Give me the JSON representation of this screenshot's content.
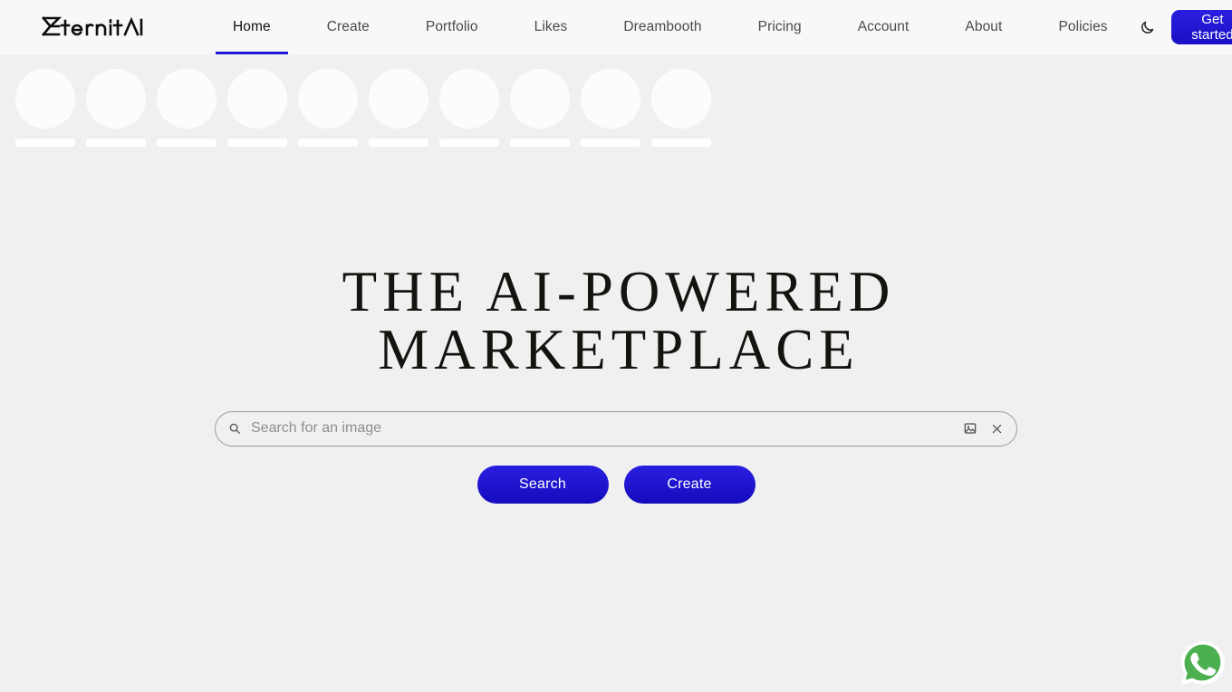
{
  "header": {
    "logo_text": "EternitAI",
    "logo_icon": "eternitai-wordmark",
    "nav": [
      {
        "label": "Home",
        "active": true
      },
      {
        "label": "Create",
        "active": false
      },
      {
        "label": "Portfolio",
        "active": false
      },
      {
        "label": "Likes",
        "active": false
      },
      {
        "label": "Dreambooth",
        "active": false
      },
      {
        "label": "Pricing",
        "active": false
      },
      {
        "label": "Account",
        "active": false
      },
      {
        "label": "About",
        "active": false
      },
      {
        "label": "Policies",
        "active": false
      }
    ],
    "theme_toggle_icon": "moon-icon",
    "get_started_label": "Get started"
  },
  "skeleton": {
    "count": 10,
    "circle_color": "#fcfcfc",
    "bar_color": "#ffffff"
  },
  "hero": {
    "title_line1": "THE AI-POWERED",
    "title_line2": "MARKETPLACE"
  },
  "search": {
    "placeholder": "Search for an image",
    "value": "",
    "search_icon": "search-icon",
    "image_upload_icon": "image-icon",
    "clear_icon": "close-icon"
  },
  "actions": {
    "search_label": "Search",
    "create_label": "Create"
  },
  "floating": {
    "whatsapp_icon": "whatsapp-icon"
  },
  "colors": {
    "accent": "#2016d8",
    "page_bg": "#f0f0f0",
    "header_bg": "#f8f8f8",
    "whatsapp_green": "#4caf50"
  }
}
